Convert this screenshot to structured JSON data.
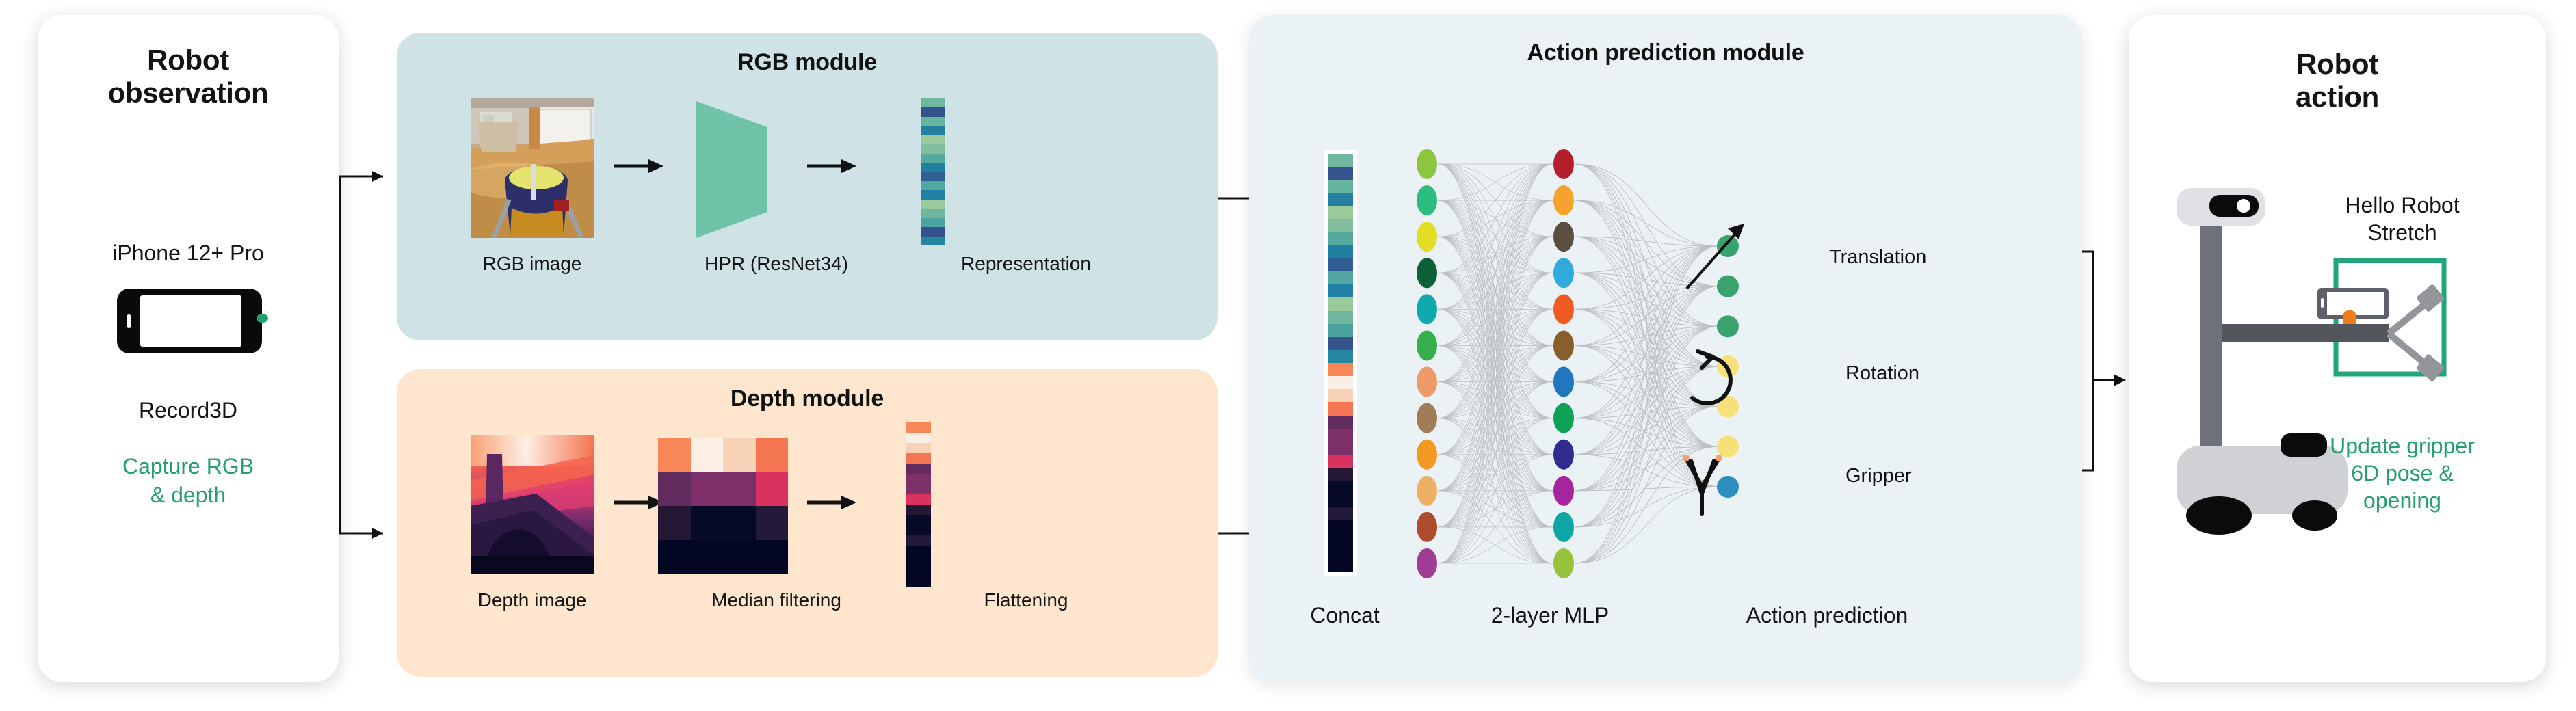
{
  "panels": {
    "observation": {
      "title": "Robot\nobservation",
      "title_line1": "Robot",
      "title_line2": "observation",
      "device_label": "iPhone 12+ Pro",
      "app_label": "Record3D",
      "capture_label_line1": "Capture RGB",
      "capture_label_line2": "& depth",
      "accent_color": "#23a06e"
    },
    "rgb_module": {
      "title": "RGB module",
      "background": "#cfe2e5",
      "steps": [
        {
          "label": "RGB image",
          "kind": "image-thumbnail"
        },
        {
          "label": "HPR (ResNet34)",
          "kind": "trapezoid-encoder"
        },
        {
          "label": "Representation",
          "kind": "feature-vector"
        }
      ],
      "encoder_color": "#6ec3a8",
      "representation_colors": [
        "#6fb79e",
        "#34538c",
        "#65b59f",
        "#2380a0",
        "#9ac99b",
        "#82bda0",
        "#55aa9f",
        "#217fa2",
        "#2e5e93",
        "#51a8a0",
        "#2181a4",
        "#9ac99b",
        "#6fb79e",
        "#4aa39e",
        "#34538c",
        "#2687a2"
      ]
    },
    "depth_module": {
      "title": "Depth module",
      "background": "#fde6cd",
      "steps": [
        {
          "label": "Depth image",
          "kind": "image-thumbnail"
        },
        {
          "label": "Median filtering",
          "kind": "pixel-grid"
        },
        {
          "label": "Flattening",
          "kind": "feature-vector"
        }
      ],
      "median_grid": [
        [
          "#f78757",
          "#fbeee4",
          "#f9d3b8",
          "#f47551"
        ],
        [
          "#632c5f",
          "#7d3069",
          "#7d3069",
          "#d9325f"
        ],
        [
          "#241734",
          "#060a26",
          "#060a26",
          "#231a39"
        ],
        [
          "#030723",
          "#030723",
          "#030723",
          "#030723"
        ]
      ],
      "flatten_colors": [
        "#f78757",
        "#fbeee4",
        "#f9d3b8",
        "#f47551",
        "#632c5f",
        "#7d3069",
        "#7d3069",
        "#d9325f",
        "#241734",
        "#060a26",
        "#060a26",
        "#231a39",
        "#030723",
        "#030723",
        "#030723",
        "#030723"
      ]
    },
    "action_module": {
      "title": "Action prediction module",
      "background": "#eaf2f5",
      "captions": {
        "concat": "Concat",
        "mlp": "2-layer MLP",
        "prediction": "Action prediction"
      },
      "concat_colors": [
        "#6fb79e",
        "#34538c",
        "#65b59f",
        "#2380a0",
        "#9ac99b",
        "#82bda0",
        "#55aa9f",
        "#217fa2",
        "#2e5e93",
        "#51a8a0",
        "#2181a4",
        "#9ac99b",
        "#6fb79e",
        "#4aa39e",
        "#34538c",
        "#2687a2",
        "#f78757",
        "#fbeee4",
        "#f9d3b8",
        "#f47551",
        "#632c5f",
        "#7d3069",
        "#7d3069",
        "#d9325f",
        "#241734",
        "#060a26",
        "#060a26",
        "#231a39",
        "#030723",
        "#030723",
        "#030723",
        "#030723"
      ],
      "layers": {
        "input_node_colors": [
          "#8cc63e",
          "#2bbd7e",
          "#e2de25",
          "#0c6236",
          "#10a9ae",
          "#36ae4b",
          "#f19a69",
          "#a07d56",
          "#f49a22",
          "#efb063",
          "#ad4b2c",
          "#a03c96"
        ],
        "hidden_node_colors": [
          "#b51f2c",
          "#f5a32e",
          "#5b4f42",
          "#31aade",
          "#f05a23",
          "#8a5e2a",
          "#2077bd",
          "#0da255",
          "#312b8f",
          "#a4259c",
          "#0ea5a5",
          "#96c23c"
        ],
        "output_node_colors": [
          "#39a26e",
          "#39a26e",
          "#39a26e",
          "#f6e07a",
          "#f6e07a",
          "#f6e07a",
          "#2c8fbd"
        ],
        "edge_color": "#9a9a9a"
      },
      "outputs": [
        {
          "label": "Translation",
          "icon": "diagonal-arrow-icon",
          "node_count": 3
        },
        {
          "label": "Rotation",
          "icon": "circular-arrow-icon",
          "node_count": 3
        },
        {
          "label": "Gripper",
          "icon": "gripper-fork-icon",
          "node_count": 1
        }
      ]
    },
    "robot_action": {
      "title_line1": "Robot",
      "title_line2": "action",
      "robot_name_line1": "Hello Robot",
      "robot_name_line2": "Stretch",
      "update_line1": "Update gripper",
      "update_line2": "6D pose &",
      "update_line3": "opening",
      "highlight_color": "#1fa77a",
      "accent_color": "#23a06e"
    }
  },
  "icons": {
    "flow_arrow": "arrow-right-icon",
    "translation": "diagonal-arrow-icon",
    "rotation": "circular-arrow-icon",
    "gripper": "gripper-fork-icon"
  }
}
